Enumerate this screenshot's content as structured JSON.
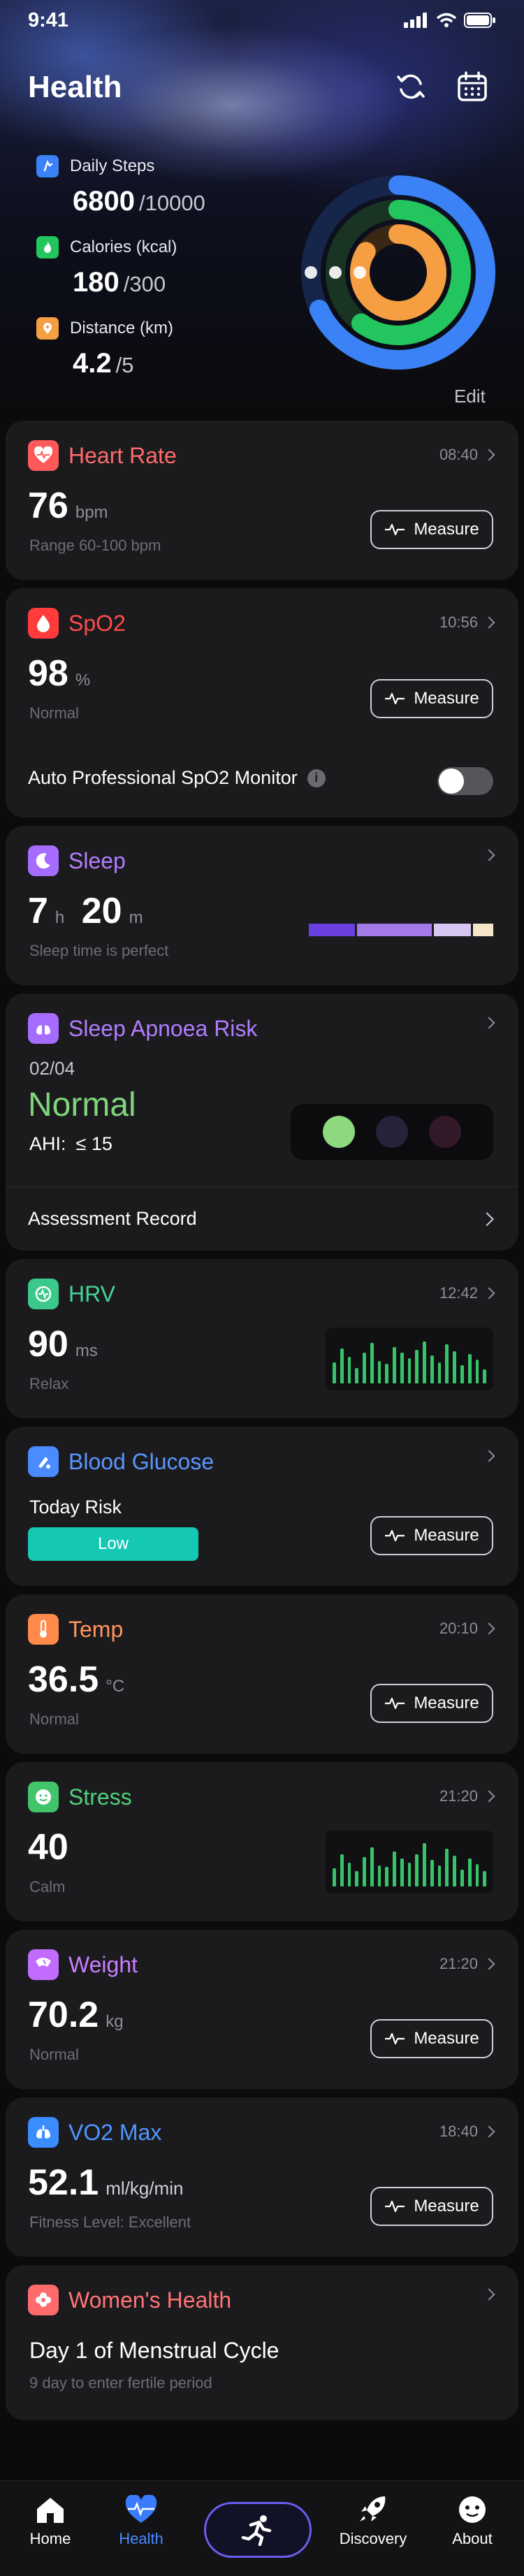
{
  "status_bar": {
    "time": "9:41"
  },
  "header": {
    "title": "Health"
  },
  "summary": {
    "steps": {
      "label": "Daily Steps",
      "value": "6800",
      "goal": "/10000"
    },
    "calories": {
      "label": "Calories (kcal)",
      "value": "180",
      "goal": "/300"
    },
    "distance": {
      "label": "Distance (km)",
      "value": "4.2",
      "goal": "/5"
    },
    "edit_label": "Edit",
    "progress": {
      "steps": 0.68,
      "calories": 0.6,
      "distance": 0.84
    }
  },
  "heart_rate": {
    "title": "Heart Rate",
    "time": "08:40",
    "value": "76",
    "unit": "bpm",
    "sub": "Range 60-100 bpm",
    "measure": "Measure"
  },
  "spo2": {
    "title": "SpO2",
    "time": "10:56",
    "value": "98",
    "unit": "%",
    "sub": "Normal",
    "measure": "Measure",
    "monitor_label": "Auto Professional SpO2 Monitor",
    "monitor_on": false
  },
  "sleep": {
    "title": "Sleep",
    "hours": "7",
    "h_unit": "h",
    "minutes": "20",
    "m_unit": "m",
    "sub": "Sleep time is perfect"
  },
  "apnoea": {
    "title": "Sleep Apnoea Risk",
    "date": "02/04",
    "status": "Normal",
    "ahi_label": "AHI:",
    "ahi_value": "≤ 15",
    "record_label": "Assessment Record"
  },
  "hrv": {
    "title": "HRV",
    "time": "12:42",
    "value": "90",
    "unit": "ms",
    "sub": "Relax"
  },
  "glucose": {
    "title": "Blood Glucose",
    "risk_label": "Today Risk",
    "risk_value": "Low",
    "measure": "Measure"
  },
  "temp": {
    "title": "Temp",
    "time": "20:10",
    "value": "36.5",
    "unit": "°C",
    "sub": "Normal",
    "measure": "Measure"
  },
  "stress": {
    "title": "Stress",
    "time": "21:20",
    "value": "40",
    "sub": "Calm"
  },
  "weight": {
    "title": "Weight",
    "time": "21:20",
    "value": "70.2",
    "unit": "kg",
    "sub": "Normal",
    "measure": "Measure"
  },
  "vo2": {
    "title": "VO2 Max",
    "time": "18:40",
    "value": "52.1",
    "unit": "ml/kg/min",
    "sub": "Fitness Level:  Excellent",
    "measure": "Measure"
  },
  "womens": {
    "title": "Women's Health",
    "headline": "Day 1 of Menstrual Cycle",
    "sub": "9 day to enter fertile period"
  },
  "nav": {
    "home": "Home",
    "health": "Health",
    "discovery": "Discovery",
    "about": "About"
  },
  "colors": {
    "heart": "#ff5a5a",
    "spo2": "#ff3b3b",
    "sleep": "#a66bff",
    "hrv": "#3ac98a",
    "glucose": "#4a8bff",
    "temp": "#ff8a4a",
    "stress": "#41c46a",
    "weight": "#c16cff",
    "vo2": "#3b8cff",
    "womens": "#ff6b6b",
    "teal": "#14c8b4"
  }
}
